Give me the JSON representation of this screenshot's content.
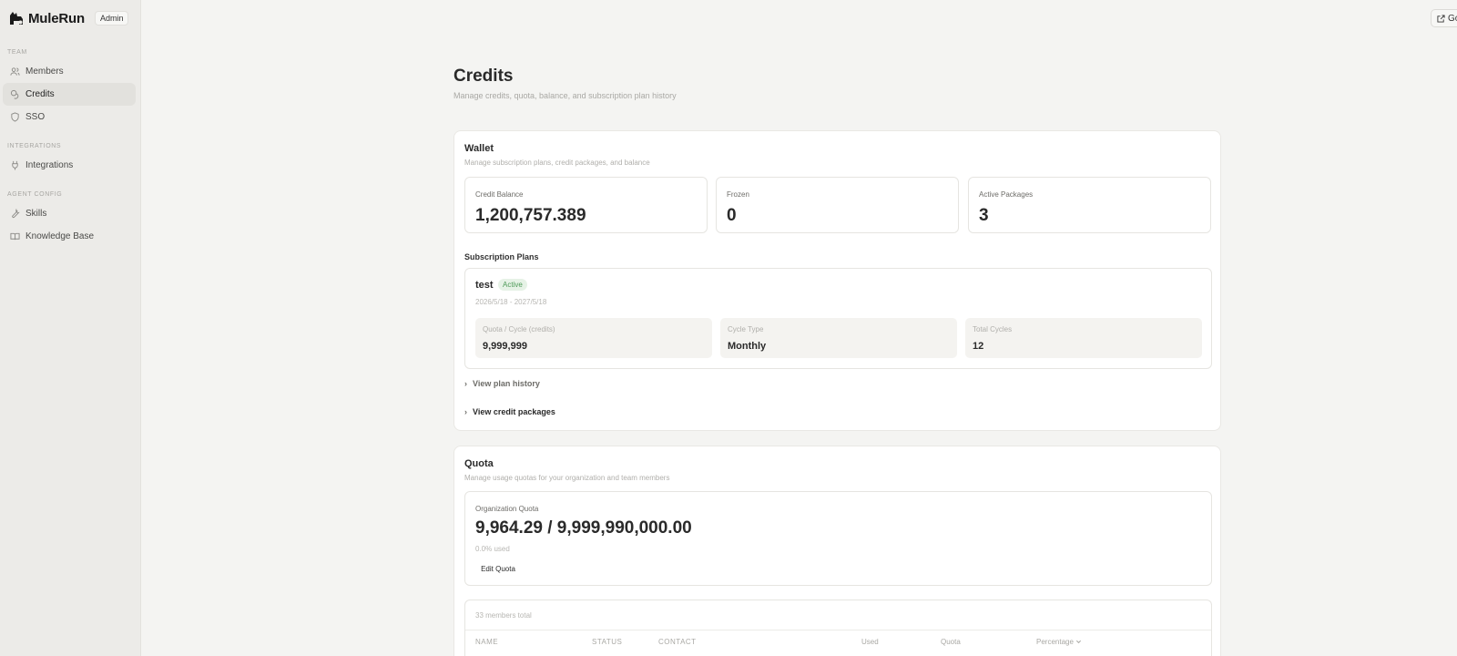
{
  "brand": {
    "name": "MuleRun",
    "badge": "Admin"
  },
  "sidebar": {
    "sections": [
      {
        "label": "TEAM"
      },
      {
        "label": "INTEGRATIONS"
      },
      {
        "label": "AGENT CONFIG"
      }
    ],
    "items": [
      {
        "label": "Members",
        "icon": "users-icon"
      },
      {
        "label": "Credits",
        "icon": "coins-icon",
        "active": true
      },
      {
        "label": "SSO",
        "icon": "shield-icon"
      },
      {
        "label": "Integrations",
        "icon": "plug-icon"
      },
      {
        "label": "Skills",
        "icon": "wrench-icon"
      },
      {
        "label": "Knowledge Base",
        "icon": "book-icon"
      }
    ]
  },
  "topbar": {
    "goto_label": "Go"
  },
  "page": {
    "title": "Credits",
    "subtitle": "Manage credits, quota, balance, and subscription plan history"
  },
  "wallet": {
    "title": "Wallet",
    "subtitle": "Manage subscription plans, credit packages, and balance",
    "stats": [
      {
        "label": "Credit Balance",
        "value": "1,200,757.389"
      },
      {
        "label": "Frozen",
        "value": "0"
      },
      {
        "label": "Active Packages",
        "value": "3"
      }
    ],
    "plans_heading": "Subscription Plans",
    "plan": {
      "name": "test",
      "status": "Active",
      "dates": "2026/5/18 - 2027/5/18",
      "metrics": [
        {
          "label": "Quota / Cycle (credits)",
          "value": "9,999,999"
        },
        {
          "label": "Cycle Type",
          "value": "Monthly"
        },
        {
          "label": "Total Cycles",
          "value": "12"
        }
      ]
    },
    "view_plan_history": "View plan history",
    "view_credit_packages": "View credit packages"
  },
  "quota": {
    "title": "Quota",
    "subtitle": "Manage usage quotas for your organization and team members",
    "org_label": "Organization Quota",
    "org_value": "9,964.29 / 9,999,990,000.00",
    "used_text": "0.0% used",
    "edit_label": "Edit Quota",
    "members_total": "33 members total",
    "columns": [
      "NAME",
      "STATUS",
      "CONTACT",
      "Used",
      "Quota",
      "Percentage"
    ]
  },
  "colors": {
    "accent_active_bg": "#e2e1dd",
    "active_badge": "#4e9a58"
  }
}
